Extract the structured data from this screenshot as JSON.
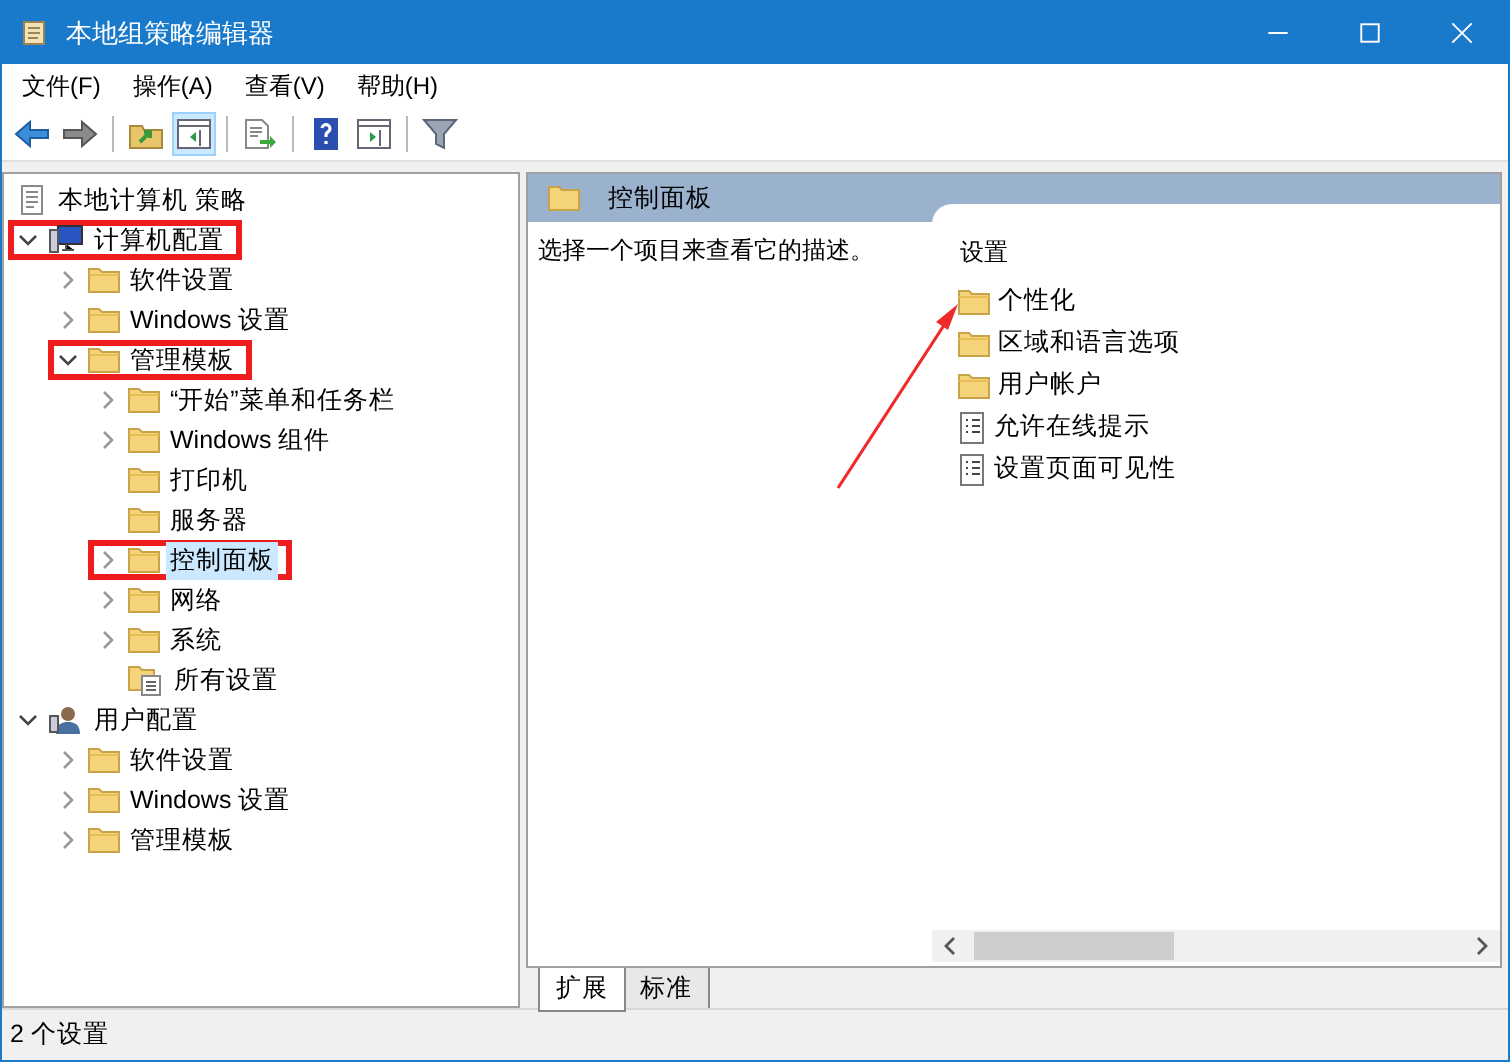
{
  "window": {
    "title": "本地组策略编辑器"
  },
  "menu": [
    "文件(F)",
    "操作(A)",
    "查看(V)",
    "帮助(H)"
  ],
  "toolbar": [
    {
      "kind": "back",
      "pressed": false
    },
    {
      "kind": "forward",
      "pressed": false
    },
    {
      "kind": "sep"
    },
    {
      "kind": "up",
      "pressed": false
    },
    {
      "kind": "tree",
      "pressed": true
    },
    {
      "kind": "sep"
    },
    {
      "kind": "export",
      "pressed": false
    },
    {
      "kind": "sep"
    },
    {
      "kind": "help",
      "pressed": false
    },
    {
      "kind": "pane",
      "pressed": false
    },
    {
      "kind": "sep"
    },
    {
      "kind": "filter",
      "pressed": false
    }
  ],
  "tree_root": {
    "label": "本地计算机 策略"
  },
  "tree": [
    {
      "label": "计算机配置",
      "kind": "computer",
      "expandable": true,
      "expanded": true,
      "selected": false,
      "highlighted": true,
      "children": [
        {
          "label": "软件设置",
          "kind": "folder",
          "expandable": true,
          "expanded": false,
          "selected": false,
          "highlighted": false
        },
        {
          "label": "Windows 设置",
          "kind": "folder",
          "expandable": true,
          "expanded": false,
          "selected": false,
          "highlighted": false
        },
        {
          "label": "管理模板",
          "kind": "folder",
          "expandable": true,
          "expanded": true,
          "selected": false,
          "highlighted": true,
          "children": [
            {
              "label": "“开始”菜单和任务栏",
              "kind": "folder",
              "expandable": true,
              "expanded": false,
              "selected": false,
              "highlighted": false
            },
            {
              "label": "Windows 组件",
              "kind": "folder",
              "expandable": true,
              "expanded": false,
              "selected": false,
              "highlighted": false
            },
            {
              "label": "打印机",
              "kind": "folder",
              "expandable": false,
              "selected": false,
              "highlighted": false
            },
            {
              "label": "服务器",
              "kind": "folder",
              "expandable": false,
              "selected": false,
              "highlighted": false
            },
            {
              "label": "控制面板",
              "kind": "folder",
              "expandable": true,
              "expanded": false,
              "selected": true,
              "highlighted": true
            },
            {
              "label": "网络",
              "kind": "folder",
              "expandable": true,
              "expanded": false,
              "selected": false,
              "highlighted": false
            },
            {
              "label": "系统",
              "kind": "folder",
              "expandable": true,
              "expanded": false,
              "selected": false,
              "highlighted": false
            },
            {
              "label": "所有设置",
              "kind": "all",
              "expandable": false,
              "selected": false,
              "highlighted": false
            }
          ]
        }
      ]
    },
    {
      "label": "用户配置",
      "kind": "user",
      "expandable": true,
      "expanded": true,
      "selected": false,
      "highlighted": false,
      "children": [
        {
          "label": "软件设置",
          "kind": "folder",
          "expandable": true,
          "expanded": false,
          "selected": false,
          "highlighted": false
        },
        {
          "label": "Windows 设置",
          "kind": "folder",
          "expandable": true,
          "expanded": false,
          "selected": false,
          "highlighted": false
        },
        {
          "label": "管理模板",
          "kind": "folder",
          "expandable": true,
          "expanded": false,
          "selected": false,
          "highlighted": false
        }
      ]
    }
  ],
  "detail": {
    "title": "控制面板",
    "description": "选择一个项目来查看它的描述。",
    "list_header": "设置",
    "items": [
      {
        "label": "个性化",
        "kind": "folder"
      },
      {
        "label": "区域和语言选项",
        "kind": "folder"
      },
      {
        "label": "用户帐户",
        "kind": "folder"
      },
      {
        "label": "允许在线提示",
        "kind": "setting"
      },
      {
        "label": "设置页面可见性",
        "kind": "setting"
      }
    ]
  },
  "tabs": [
    {
      "label": "扩展",
      "selected": true
    },
    {
      "label": "标准",
      "selected": false
    }
  ],
  "status_bar": "2 个设置"
}
